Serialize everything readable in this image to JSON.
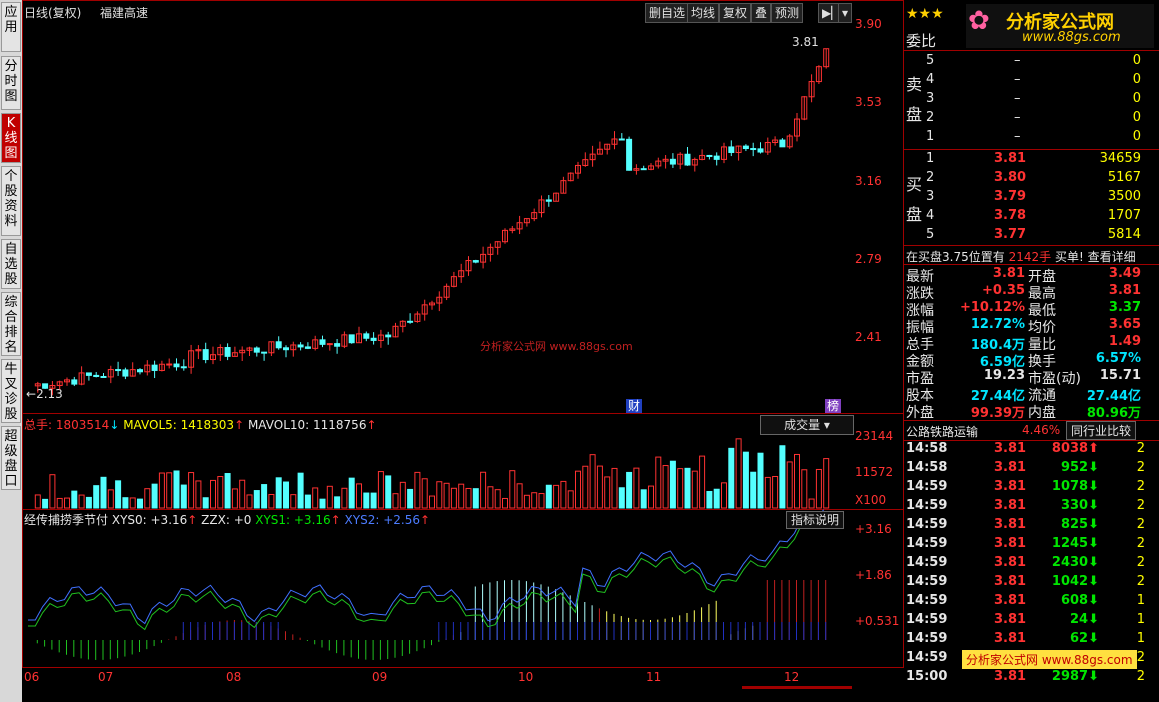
{
  "left_tabs": [
    {
      "label": "应用",
      "active": false
    },
    {
      "label": "分时图",
      "active": false
    },
    {
      "label": "K线图",
      "active": true
    },
    {
      "label": "个股资料",
      "active": false
    },
    {
      "label": "自选股",
      "active": false
    },
    {
      "label": "综合排名",
      "active": false
    },
    {
      "label": "牛叉诊股",
      "active": false
    },
    {
      "label": "超级盘口",
      "active": false
    }
  ],
  "kline": {
    "period": "日线(复权)",
    "stock_name": "福建高速",
    "toolbar": [
      "删自选",
      "均线",
      "复权",
      "叠",
      "预测"
    ],
    "price_axis": [
      "3.90",
      "3.53",
      "3.16",
      "2.79",
      "2.41"
    ],
    "high_label": "3.81",
    "low_label": "2.13",
    "event_cai": "财",
    "event_bang": "榜",
    "watermark": "分析家公式网 www.88gs.com"
  },
  "volume": {
    "label_total": "总手: 1803514",
    "label_mavol5": "MAVOL5: 1418303",
    "label_mavol10": "MAVOL10: 1118756",
    "dropdown": "成交量",
    "axis": [
      "23144",
      "11572",
      "X100"
    ]
  },
  "indicator": {
    "title": "经传捕捞季节付",
    "xys0": "XYS0: +3.16",
    "zzx": "ZZX: +0",
    "xys1": "XYS1: +3.16",
    "xys2": "XYS2: +2.56",
    "help_button": "指标说明",
    "axis": [
      "+3.16",
      "+1.86",
      "+0.531"
    ]
  },
  "date_axis": [
    "06",
    "07",
    "08",
    "09",
    "10",
    "11",
    "12"
  ],
  "colors": {
    "up": "#ff3232",
    "down": "#54ffff",
    "border": "#a00000",
    "bg": "#000000"
  },
  "right": {
    "stars": "★★★",
    "logo_text": "分析家公式网",
    "logo_url": "www.88gs.com",
    "weibi": "委比",
    "sell_label": "卖盘",
    "buy_label": "买盘",
    "sell": [
      {
        "n": "5",
        "price": "–",
        "vol": "0"
      },
      {
        "n": "4",
        "price": "–",
        "vol": "0"
      },
      {
        "n": "3",
        "price": "–",
        "vol": "0"
      },
      {
        "n": "2",
        "price": "–",
        "vol": "0"
      },
      {
        "n": "1",
        "price": "–",
        "vol": "0"
      }
    ],
    "buy": [
      {
        "n": "1",
        "price": "3.81",
        "vol": "34659"
      },
      {
        "n": "2",
        "price": "3.80",
        "vol": "5167"
      },
      {
        "n": "3",
        "price": "3.79",
        "vol": "3500"
      },
      {
        "n": "4",
        "price": "3.78",
        "vol": "1707"
      },
      {
        "n": "5",
        "price": "3.77",
        "vol": "5814"
      }
    ],
    "notice": {
      "prefix": "在买盘3.75位置有",
      "qty": "2142手",
      "suffix": "买单!",
      "link": "查看详细"
    },
    "quote": [
      {
        "l": "最新",
        "v": "3.81",
        "vc": "red",
        "l2": "开盘",
        "v2": "3.49",
        "v2c": "red"
      },
      {
        "l": "涨跌",
        "v": "+0.35",
        "vc": "red",
        "l2": "最高",
        "v2": "3.81",
        "v2c": "red"
      },
      {
        "l": "涨幅",
        "v": "+10.12%",
        "vc": "red",
        "l2": "最低",
        "v2": "3.37",
        "v2c": "green"
      },
      {
        "l": "振幅",
        "v": "12.72%",
        "vc": "cyan",
        "l2": "均价",
        "v2": "3.65",
        "v2c": "red"
      },
      {
        "l": "总手",
        "v": "180.4万",
        "vc": "cyan",
        "l2": "量比",
        "v2": "1.49",
        "v2c": "red"
      },
      {
        "l": "金额",
        "v": "6.59亿",
        "vc": "cyan",
        "l2": "换手",
        "v2": "6.57%",
        "v2c": "cyan"
      },
      {
        "l": "市盈",
        "v": "19.23",
        "vc": "white",
        "l2": "市盈(动)",
        "v2": "15.71",
        "v2c": "white"
      },
      {
        "l": "股本",
        "v": "27.44亿",
        "vc": "cyan",
        "l2": "流通",
        "v2": "27.44亿",
        "v2c": "cyan"
      },
      {
        "l": "外盘",
        "v": "99.39万",
        "vc": "red",
        "l2": "内盘",
        "v2": "80.96万",
        "v2c": "green"
      }
    ],
    "sector": {
      "name": "公路铁路运输",
      "change": "4.46%",
      "button": "同行业比较"
    },
    "ticks": [
      {
        "t": "14:58",
        "p": "3.81",
        "v": "8038",
        "dir": "up",
        "n": "2"
      },
      {
        "t": "14:58",
        "p": "3.81",
        "v": "952",
        "dir": "down",
        "n": "2"
      },
      {
        "t": "14:59",
        "p": "3.81",
        "v": "1078",
        "dir": "down",
        "n": "2"
      },
      {
        "t": "14:59",
        "p": "3.81",
        "v": "330",
        "dir": "down",
        "n": "2"
      },
      {
        "t": "14:59",
        "p": "3.81",
        "v": "825",
        "dir": "down",
        "n": "2"
      },
      {
        "t": "14:59",
        "p": "3.81",
        "v": "1245",
        "dir": "down",
        "n": "2"
      },
      {
        "t": "14:59",
        "p": "3.81",
        "v": "2430",
        "dir": "down",
        "n": "2"
      },
      {
        "t": "14:59",
        "p": "3.81",
        "v": "1042",
        "dir": "down",
        "n": "2"
      },
      {
        "t": "14:59",
        "p": "3.81",
        "v": "608",
        "dir": "down",
        "n": "1"
      },
      {
        "t": "14:59",
        "p": "3.81",
        "v": "24",
        "dir": "down",
        "n": "1"
      },
      {
        "t": "14:59",
        "p": "3.81",
        "v": "62",
        "dir": "down",
        "n": "1"
      },
      {
        "t": "14:59",
        "p": "",
        "v": "",
        "dir": "",
        "n": "2"
      },
      {
        "t": "15:00",
        "p": "3.81",
        "v": "2987",
        "dir": "down",
        "n": "2"
      }
    ],
    "bottom_watermark": "分析家公式网 www.88gs.com"
  }
}
